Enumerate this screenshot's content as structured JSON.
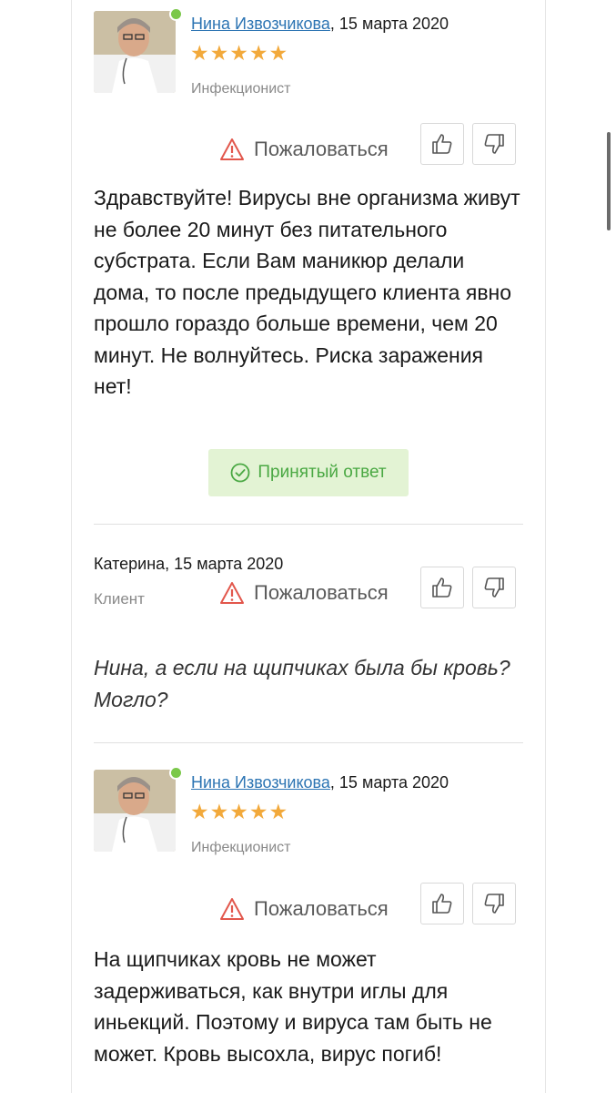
{
  "comments": [
    {
      "author": "Нина Извозчикова",
      "date_suffix": ", 15 марта 2020",
      "stars": "★★★★★",
      "role": "Инфекционист",
      "complain_label": "Пожаловаться",
      "text": "Здравствуйте! Вирусы вне организма живут не более 20 минут без питательного субстрата. Если Вам маникюр делали дома, то после предыдущего клиента явно прошло гораздо больше времени, чем 20 минут. Не волнуйтесь. Риска заражения нет!",
      "accepted_label": "Принятый ответ"
    },
    {
      "author": "Катерина",
      "date_suffix": ", 15 марта 2020",
      "role": "Клиент",
      "complain_label": "Пожаловаться",
      "text": "Нина, а если на щипчиках была бы кровь? Могло?"
    },
    {
      "author": "Нина Извозчикова",
      "date_suffix": ", 15 марта 2020",
      "stars": "★★★★★",
      "role": "Инфекционист",
      "complain_label": "Пожаловаться",
      "text": "На щипчиках кровь не может задерживаться, как внутри иглы для иньекций. Поэтому и вируса там быть не может. Кровь высохла, вирус погиб!"
    }
  ],
  "icons": {
    "thumbs_up": "thumbs-up-icon",
    "thumbs_down": "thumbs-down-icon",
    "warning": "warning-triangle-icon",
    "check": "check-circle-icon"
  },
  "colors": {
    "link": "#2c74b3",
    "star": "#f2a93b",
    "online": "#7bc84a",
    "accepted_bg": "#e3f3d4",
    "accepted_text": "#4aa843",
    "warning": "#e2574c"
  }
}
